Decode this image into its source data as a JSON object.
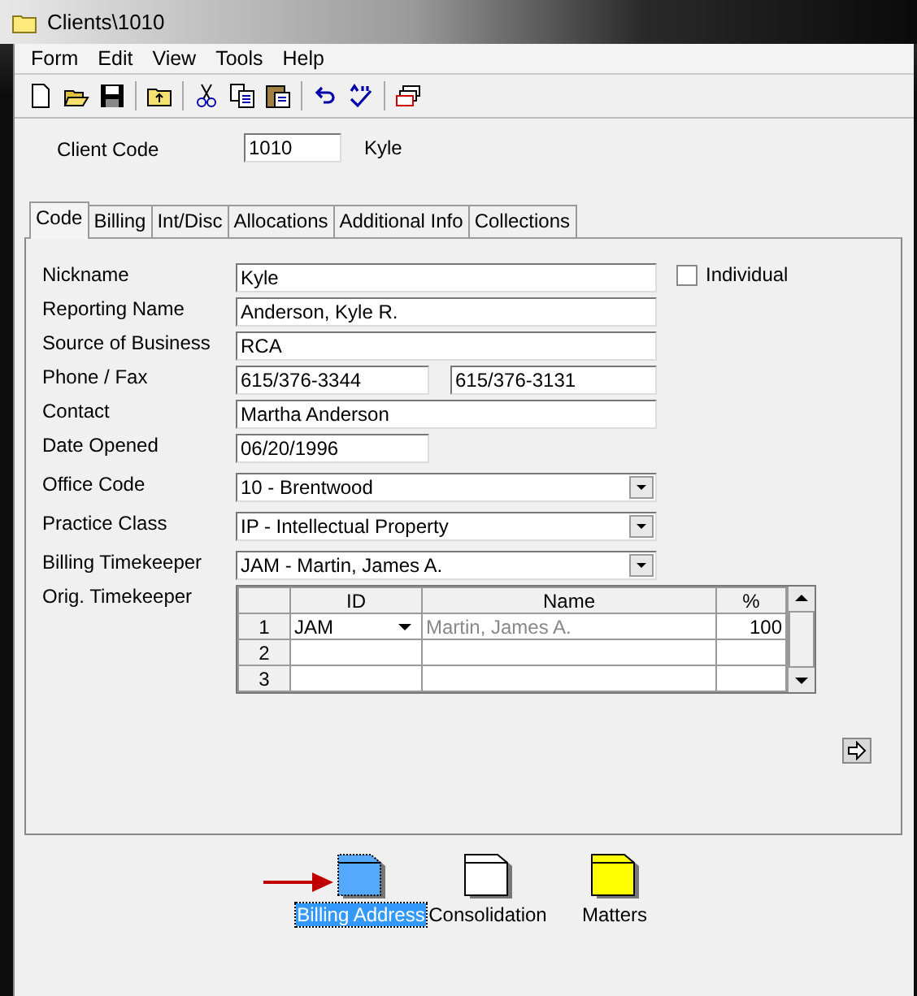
{
  "window": {
    "title": "Clients\\1010"
  },
  "menu": [
    "Form",
    "Edit",
    "View",
    "Tools",
    "Help"
  ],
  "toolbar": [
    {
      "kind": "new"
    },
    {
      "kind": "open"
    },
    {
      "kind": "save"
    },
    {
      "kind": "sep"
    },
    {
      "kind": "upfolder"
    },
    {
      "kind": "sep"
    },
    {
      "kind": "cut"
    },
    {
      "kind": "copy"
    },
    {
      "kind": "paste"
    },
    {
      "kind": "sep"
    },
    {
      "kind": "undo"
    },
    {
      "kind": "spell"
    },
    {
      "kind": "sep"
    },
    {
      "kind": "cards"
    }
  ],
  "client_code": {
    "label": "Client Code",
    "value": "1010",
    "name": "Kyle"
  },
  "tabs": [
    {
      "label": "Code",
      "selected": true
    },
    {
      "label": "Billing",
      "selected": false
    },
    {
      "label": "Int/Disc",
      "selected": false
    },
    {
      "label": "Allocations",
      "selected": false
    },
    {
      "label": "Additional Info",
      "selected": false
    },
    {
      "label": "Collections",
      "selected": false
    }
  ],
  "individual": {
    "label": "Individual",
    "checked": false
  },
  "fields": [
    {
      "label": "Nickname",
      "kind": "text",
      "value": "Kyle"
    },
    {
      "label": "Reporting Name",
      "kind": "text",
      "value": "Anderson, Kyle R."
    },
    {
      "label": "Source of Business",
      "kind": "text",
      "value": "RCA"
    },
    {
      "label": "Phone / Fax",
      "kind": "pair",
      "value": "615/376-3344",
      "value2": "615/376-3131"
    },
    {
      "label": "Contact",
      "kind": "text",
      "value": "Martha Anderson"
    },
    {
      "label": "Date Opened",
      "kind": "short",
      "value": "06/20/1996"
    },
    {
      "label": "Office Code",
      "kind": "combo",
      "value": "10 - Brentwood"
    },
    {
      "label": "Practice Class",
      "kind": "combo",
      "value": "IP - Intellectual Property"
    },
    {
      "label": "Billing Timekeeper",
      "kind": "combo",
      "value": "JAM - Martin, James A."
    }
  ],
  "orig_timekeeper": {
    "label": "Orig. Timekeeper",
    "columns": [
      "ID",
      "Name",
      "%"
    ],
    "rows": [
      {
        "num": "1",
        "id": "JAM",
        "name": "Martin, James A.",
        "pct": "100"
      },
      {
        "num": "2"
      },
      {
        "num": "3"
      }
    ]
  },
  "shortcuts": [
    {
      "label": "Billing Address",
      "selected": true,
      "color": "#55aaff"
    },
    {
      "label": "Consolidation",
      "selected": false,
      "color": "#ffffff"
    },
    {
      "label": "Matters",
      "selected": false,
      "color": "#ffff00"
    }
  ]
}
